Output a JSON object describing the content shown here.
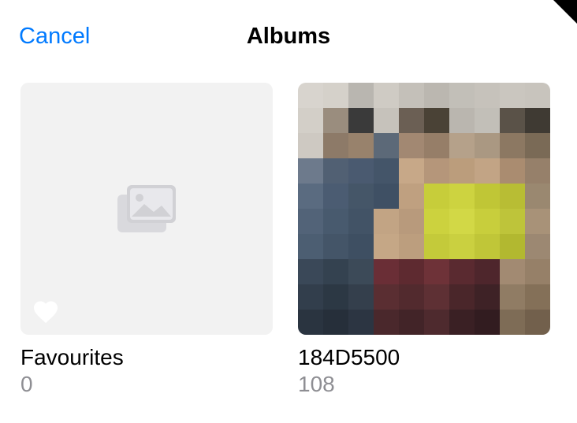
{
  "header": {
    "cancel_label": "Cancel",
    "title": "Albums"
  },
  "albums": [
    {
      "name": "Favourites",
      "count": "0"
    },
    {
      "name": "184D5500",
      "count": "108"
    }
  ]
}
